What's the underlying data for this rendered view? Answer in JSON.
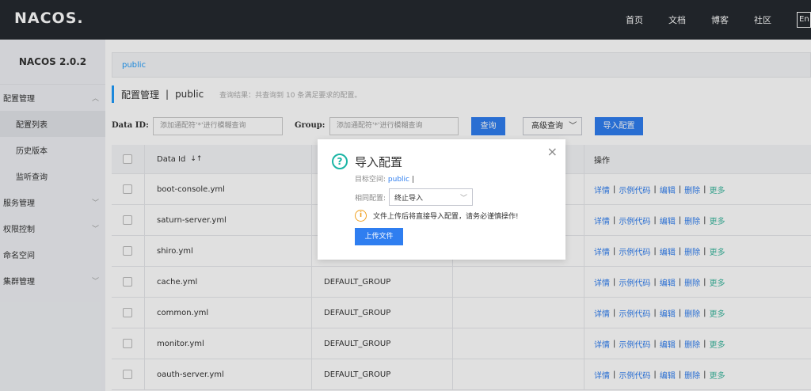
{
  "topbar": {
    "logo": "NACOS.",
    "nav": [
      "首页",
      "文档",
      "博客",
      "社区"
    ],
    "lang": "En"
  },
  "sidebar": {
    "title": "NACOS 2.0.2",
    "items": [
      {
        "label": "配置管理",
        "chevron": "^"
      },
      {
        "label": "配置列表"
      },
      {
        "label": "历史版本"
      },
      {
        "label": "监听查询"
      },
      {
        "label": "服务管理",
        "chevron": "v"
      },
      {
        "label": "权限控制",
        "chevron": "v"
      },
      {
        "label": "命名空间"
      },
      {
        "label": "集群管理",
        "chevron": "v"
      }
    ]
  },
  "breadcrumb": "public",
  "page": {
    "title": "配置管理",
    "sep": "|",
    "namespace": "public",
    "hint": "查询结果：共查询到 10 条满足要求的配置。"
  },
  "filters": {
    "dataid_label": "Data ID:",
    "dataid_placeholder": "添加通配符'*'进行模糊查询",
    "group_label": "Group:",
    "group_placeholder": "添加通配符'*'进行模糊查询",
    "query_btn": "查询",
    "advanced_btn": "高级查询",
    "import_btn": "导入配置"
  },
  "table": {
    "headers": {
      "dataid": "Data Id",
      "ops": "操作"
    },
    "rows": [
      {
        "dataid": "boot-console.yml",
        "group": ""
      },
      {
        "dataid": "saturn-server.yml",
        "group": ""
      },
      {
        "dataid": "shiro.yml",
        "group": ""
      },
      {
        "dataid": "cache.yml",
        "group": "DEFAULT_GROUP"
      },
      {
        "dataid": "common.yml",
        "group": "DEFAULT_GROUP"
      },
      {
        "dataid": "monitor.yml",
        "group": "DEFAULT_GROUP"
      },
      {
        "dataid": "oauth-server.yml",
        "group": "DEFAULT_GROUP"
      }
    ],
    "ops": {
      "detail": "详情",
      "sample": "示例代码",
      "edit": "编辑",
      "delete": "删除",
      "more": "更多",
      "sep": "|"
    }
  },
  "modal": {
    "title": "导入配置",
    "ns_label": "目标空间:",
    "ns_value": "public",
    "ns_suffix": "|",
    "policy_label": "相同配置:",
    "policy_value": "终止导入",
    "warning": "文件上传后将直接导入配置，请务必谨慎操作!",
    "upload_btn": "上传文件",
    "close": "×"
  },
  "colors": {
    "primary": "#2f7ef0",
    "topbar": "#252a2f",
    "help": "#1ab5a5",
    "warn": "#f0a020"
  }
}
